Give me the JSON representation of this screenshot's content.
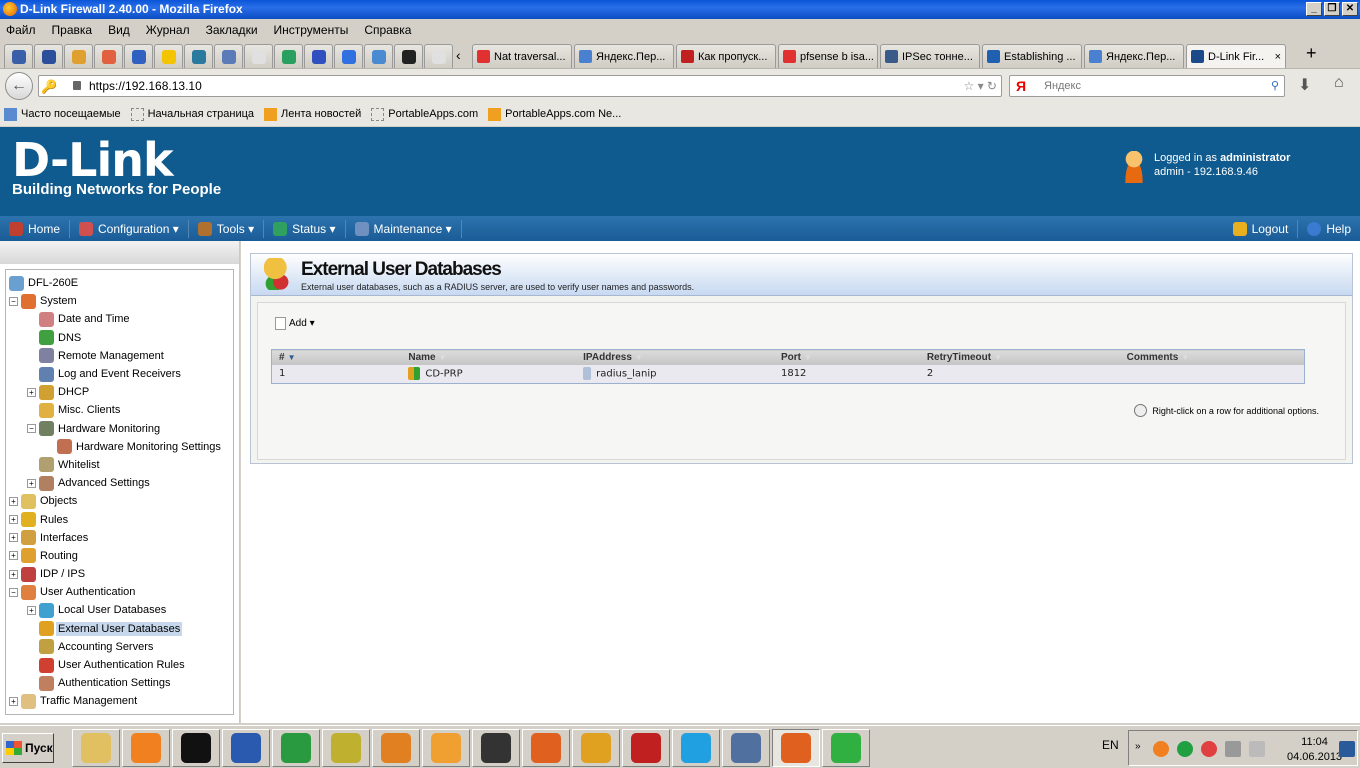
{
  "window": {
    "title": "D-Link Firewall 2.40.00 - Mozilla Firefox",
    "buttons": [
      "_",
      "❐",
      "✕"
    ]
  },
  "menu": [
    "Файл",
    "Правка",
    "Вид",
    "Журнал",
    "Закладки",
    "Инструменты",
    "Справка"
  ],
  "app_tabs": [
    {
      "icon": "shield-icon",
      "color": "#3a5fa8"
    },
    {
      "icon": "shield-icon",
      "color": "#2b4f9a"
    },
    {
      "icon": "signal-icon",
      "color": "#e0a030"
    },
    {
      "icon": "heart-icon",
      "color": "#e06040"
    },
    {
      "icon": "monitor-icon",
      "color": "#3060c0"
    },
    {
      "icon": "beeline-icon",
      "color": "#f5c400"
    },
    {
      "icon": "63-icon",
      "color": "#2a7aa0"
    },
    {
      "icon": "cart-icon",
      "color": "#5a7ab8"
    },
    {
      "icon": "blank-icon",
      "color": "#e0e0e0"
    },
    {
      "icon": "globe-icon",
      "color": "#2aa060"
    },
    {
      "icon": "dns-icon",
      "color": "#3050c0"
    },
    {
      "icon": "bird-icon",
      "color": "#3070e0"
    },
    {
      "icon": "translate-icon",
      "color": "#4a8ad0"
    },
    {
      "icon": "hh-icon",
      "color": "#222222"
    },
    {
      "icon": "blank-icon",
      "color": "#e0e0e0"
    }
  ],
  "tabs": [
    {
      "label": "Nat traversal...",
      "color": "#e03030"
    },
    {
      "label": "Яндекс.Пер...",
      "color": "#4a80d0"
    },
    {
      "label": "Как пропуск...",
      "color": "#c02020"
    },
    {
      "label": "pfsense b isa...",
      "color": "#e03030"
    },
    {
      "label": "IPSec тонне...",
      "color": "#3a5a8a"
    },
    {
      "label": "Establishing ...",
      "color": "#2060b0"
    },
    {
      "label": "Яндекс.Пер...",
      "color": "#4a80d0"
    },
    {
      "label": "D-Link Fir...",
      "color": "#1a4a8a",
      "active": true
    }
  ],
  "tab_close": "×",
  "url": "https://192.168.13.10",
  "search": {
    "placeholder": "Яндекс",
    "engine": "Я"
  },
  "bookmarks": [
    "Часто посещаемые",
    "Начальная страница",
    "Лента новостей",
    "PortableApps.com",
    "PortableApps.com Ne..."
  ],
  "header": {
    "logo": "D-Link",
    "tagline": "Building Networks for People",
    "logged_in_prefix": "Logged in as ",
    "user": "administrator",
    "session": "admin - 192.168.9.46"
  },
  "nav": {
    "items": [
      "Home",
      "Configuration ▾",
      "Tools ▾",
      "Status ▾",
      "Maintenance ▾"
    ],
    "logout": "Logout",
    "help": "Help"
  },
  "tree": [
    {
      "label": "DFL-260E",
      "level": 0
    },
    {
      "label": "System",
      "level": 0,
      "pm": "−"
    },
    {
      "label": "Date and Time",
      "level": 1
    },
    {
      "label": "DNS",
      "level": 1
    },
    {
      "label": "Remote Management",
      "level": 1
    },
    {
      "label": "Log and Event Receivers",
      "level": 1
    },
    {
      "label": "DHCP",
      "level": 1,
      "pm": "+"
    },
    {
      "label": "Misc. Clients",
      "level": 1
    },
    {
      "label": "Hardware Monitoring",
      "level": 1,
      "pm": "−"
    },
    {
      "label": "Hardware Monitoring Settings",
      "level": 2
    },
    {
      "label": "Whitelist",
      "level": 1
    },
    {
      "label": "Advanced Settings",
      "level": 1,
      "pm": "+"
    },
    {
      "label": "Objects",
      "level": 0,
      "pm": "+"
    },
    {
      "label": "Rules",
      "level": 0,
      "pm": "+"
    },
    {
      "label": "Interfaces",
      "level": 0,
      "pm": "+"
    },
    {
      "label": "Routing",
      "level": 0,
      "pm": "+"
    },
    {
      "label": "IDP / IPS",
      "level": 0,
      "pm": "+"
    },
    {
      "label": "User Authentication",
      "level": 0,
      "pm": "−"
    },
    {
      "label": "Local User Databases",
      "level": 1,
      "pm": "+"
    },
    {
      "label": "External User Databases",
      "level": 1,
      "selected": true
    },
    {
      "label": "Accounting Servers",
      "level": 1
    },
    {
      "label": "User Authentication Rules",
      "level": 1
    },
    {
      "label": "Authentication Settings",
      "level": 1
    },
    {
      "label": "Traffic Management",
      "level": 0,
      "pm": "+"
    }
  ],
  "page": {
    "title": "External User Databases",
    "description": "External user databases, such as a RADIUS server, are used to verify user names and passwords.",
    "add": "Add ▾",
    "hint": "Right-click on a row for additional options."
  },
  "table": {
    "columns": [
      "#",
      "Name",
      "IPAddress",
      "Port",
      "RetryTimeout",
      "Comments"
    ],
    "rows": [
      [
        "1",
        "CD-PRP",
        "radius_lanip",
        "1812",
        "2",
        ""
      ]
    ]
  },
  "taskbar": {
    "start": "Пуск",
    "apps": [
      "explorer",
      "nero",
      "cmd",
      "word",
      "excel",
      "app",
      "outlook-2",
      "outlook",
      "arrow",
      "firefox",
      "keys",
      "filezilla",
      "skype",
      "tool",
      "firefox-active",
      "mail-agent"
    ],
    "lang": "EN",
    "time": "11:04",
    "date": "04.06.2013"
  }
}
